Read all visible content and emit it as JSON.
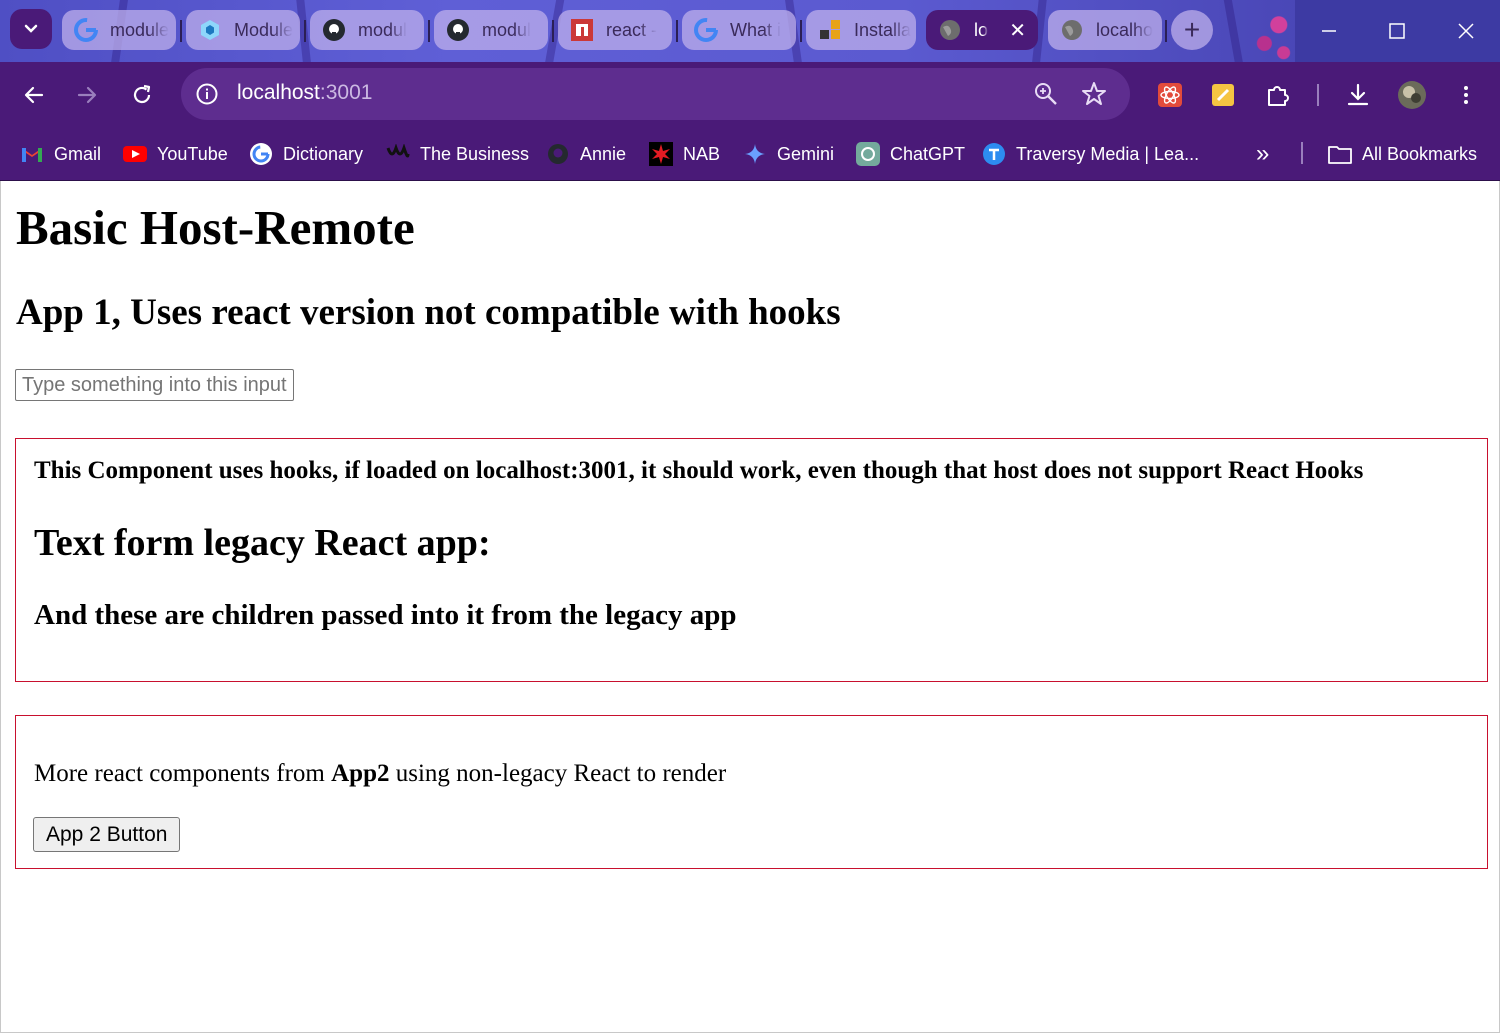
{
  "tabs": [
    {
      "title": "module",
      "favicon": "google-g-icon"
    },
    {
      "title": "Module",
      "favicon": "webpack-cube-icon"
    },
    {
      "title": "modul",
      "favicon": "github-icon"
    },
    {
      "title": "modul",
      "favicon": "github-icon"
    },
    {
      "title": "react -",
      "favicon": "npm-icon"
    },
    {
      "title": "What i",
      "favicon": "google-g-icon"
    },
    {
      "title": "Installa",
      "favicon": "blocks-icon"
    },
    {
      "title": "lo",
      "favicon": "globe-icon",
      "active": true
    },
    {
      "title": "localho",
      "favicon": "globe-icon"
    }
  ],
  "address_bar": {
    "host": "localhost",
    "port": ":3001"
  },
  "bookmarks": [
    {
      "label": "Gmail",
      "icon": "gmail-icon"
    },
    {
      "label": "YouTube",
      "icon": "youtube-icon"
    },
    {
      "label": "Dictionary",
      "icon": "google-g-icon"
    },
    {
      "label": "The Business",
      "icon": "abc-icon"
    },
    {
      "label": "Annie",
      "icon": "github-icon"
    },
    {
      "label": "NAB",
      "icon": "nab-star-icon"
    },
    {
      "label": "Gemini",
      "icon": "gemini-sparkle-icon"
    },
    {
      "label": "ChatGPT",
      "icon": "chatgpt-icon"
    },
    {
      "label": "Traversy Media | Lea...",
      "icon": "traversy-icon"
    }
  ],
  "all_bookmarks_label": "All Bookmarks",
  "page": {
    "title": "Basic Host-Remote",
    "subtitle": "App 1, Uses react version not compatible with hooks",
    "input_placeholder": "Type something into this input",
    "box1": {
      "notice": "This Component uses hooks, if loaded on localhost:3001, it should work, even though that host does not support React Hooks",
      "heading": "Text form legacy React app:",
      "children_text": "And these are children passed into it from the legacy app"
    },
    "box2": {
      "text_before": "More react components from ",
      "text_bold": "App2",
      "text_after": " using non-legacy React to render",
      "button_label": "App 2 Button"
    }
  },
  "colors": {
    "tab_bar": "#5b5ad0",
    "toolbar": "#4a1a78",
    "box_border": "#c8102e"
  }
}
